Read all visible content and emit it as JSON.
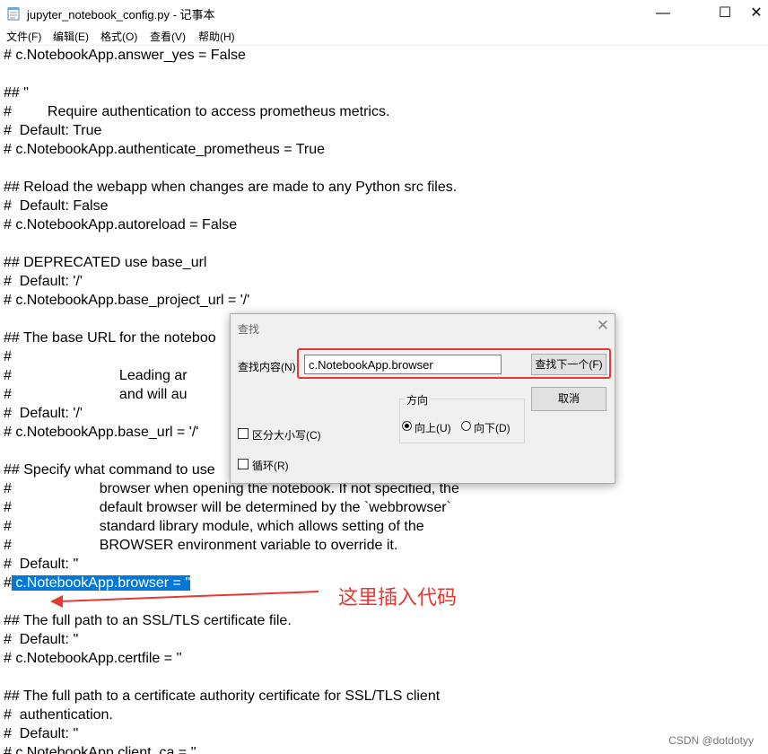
{
  "window": {
    "title": "jupyter_notebook_config.py - 记事本",
    "icon": "notepad-icon",
    "minimize": "—",
    "maximize": "☐",
    "close": "✕"
  },
  "menu": [
    "文件(F)",
    "编辑(E)",
    "格式(O)",
    "查看(V)",
    "帮助(H)"
  ],
  "lines": [
    "# c.NotebookApp.answer_yes = False",
    "",
    "## \"",
    "#         Require authentication to access prometheus metrics.",
    "#  Default: True",
    "# c.NotebookApp.authenticate_prometheus = True",
    "",
    "## Reload the webapp when changes are made to any Python src files.",
    "#  Default: False",
    "# c.NotebookApp.autoreload = False",
    "",
    "## DEPRECATED use base_url",
    "#  Default: '/'",
    "# c.NotebookApp.base_project_url = '/'",
    "",
    "## The base URL for the noteboo",
    "#",
    "#                           Leading ar",
    "#                           and will au",
    "#  Default: '/'",
    "# c.NotebookApp.base_url = '/'",
    "",
    "## Specify what command to use",
    "#                      browser when opening the notebook. If not specified, the",
    "#                      default browser will be determined by the `webbrowser`",
    "#                      standard library module, which allows setting of the",
    "#                      BROWSER environment variable to override it.",
    "#  Default: ''",
    "",
    "",
    "## The full path to an SSL/TLS certificate file.",
    "#  Default: ''",
    "# c.NotebookApp.certfile = ''",
    "",
    "## The full path to a certificate authority certificate for SSL/TLS client",
    "#  authentication.",
    "#  Default: ''",
    "# c.NotebookApp.client_ca = ''"
  ],
  "selected_line": {
    "prefix": "#",
    "selected": " c.NotebookApp.browser = ''"
  },
  "find_dialog": {
    "title": "查找",
    "close": "✕",
    "find_label": "查找内容(N)",
    "find_value": "c.NotebookApp.browser",
    "find_next": "查找下一个(F)",
    "cancel": "取消",
    "direction_label": "方向",
    "up": "向上(U)",
    "down": "向下(D)",
    "match_case": "区分大小写(C)",
    "wrap": "循环(R)",
    "direction_selected": "up"
  },
  "annotation": {
    "text": "这里插入代码",
    "color": "#e53935"
  },
  "watermark": "CSDN @dotdotyy",
  "colors": {
    "selection": "#0078d7",
    "highlight_box": "#e53935"
  }
}
